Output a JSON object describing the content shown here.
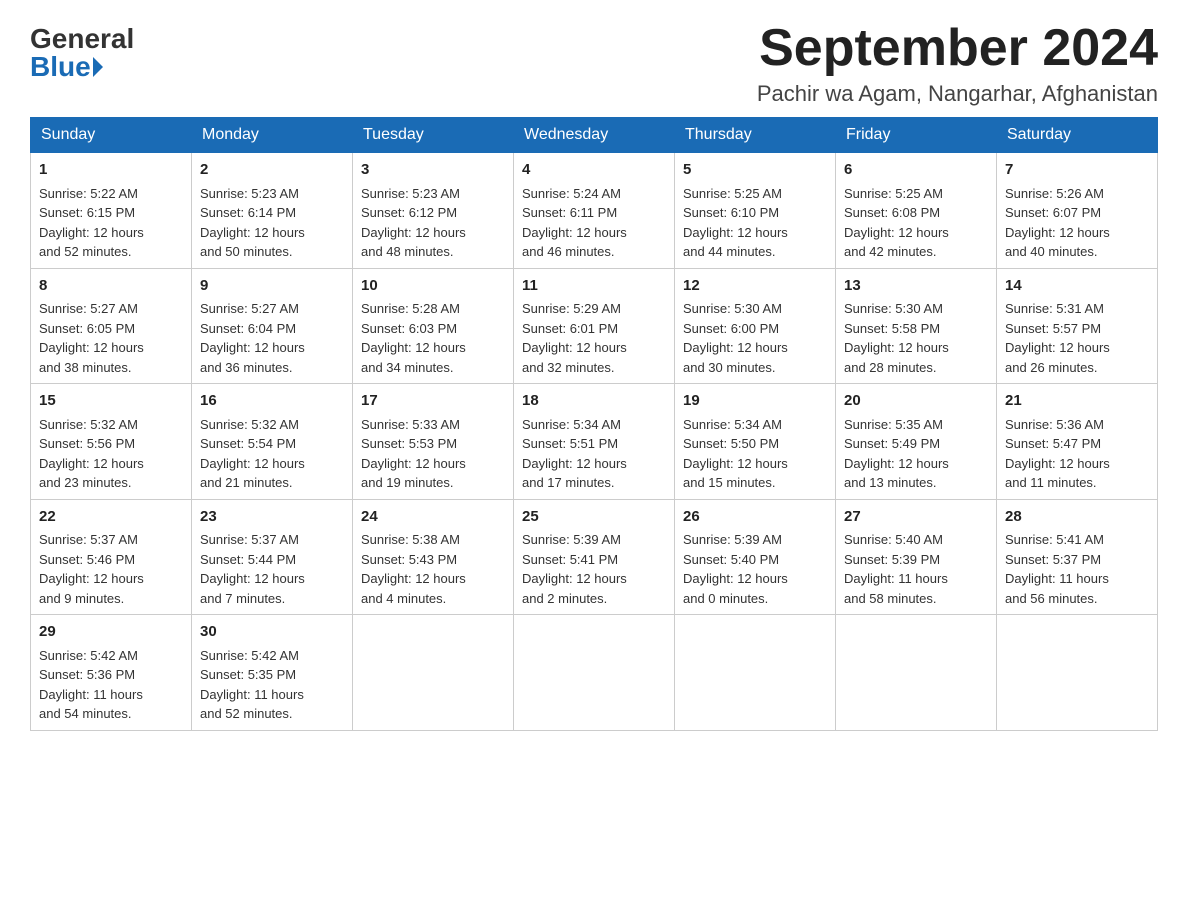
{
  "header": {
    "title": "September 2024",
    "subtitle": "Pachir wa Agam, Nangarhar, Afghanistan",
    "logo_general": "General",
    "logo_blue": "Blue"
  },
  "weekdays": [
    "Sunday",
    "Monday",
    "Tuesday",
    "Wednesday",
    "Thursday",
    "Friday",
    "Saturday"
  ],
  "weeks": [
    [
      {
        "day": "1",
        "sunrise": "5:22 AM",
        "sunset": "6:15 PM",
        "daylight": "12 hours and 52 minutes."
      },
      {
        "day": "2",
        "sunrise": "5:23 AM",
        "sunset": "6:14 PM",
        "daylight": "12 hours and 50 minutes."
      },
      {
        "day": "3",
        "sunrise": "5:23 AM",
        "sunset": "6:12 PM",
        "daylight": "12 hours and 48 minutes."
      },
      {
        "day": "4",
        "sunrise": "5:24 AM",
        "sunset": "6:11 PM",
        "daylight": "12 hours and 46 minutes."
      },
      {
        "day": "5",
        "sunrise": "5:25 AM",
        "sunset": "6:10 PM",
        "daylight": "12 hours and 44 minutes."
      },
      {
        "day": "6",
        "sunrise": "5:25 AM",
        "sunset": "6:08 PM",
        "daylight": "12 hours and 42 minutes."
      },
      {
        "day": "7",
        "sunrise": "5:26 AM",
        "sunset": "6:07 PM",
        "daylight": "12 hours and 40 minutes."
      }
    ],
    [
      {
        "day": "8",
        "sunrise": "5:27 AM",
        "sunset": "6:05 PM",
        "daylight": "12 hours and 38 minutes."
      },
      {
        "day": "9",
        "sunrise": "5:27 AM",
        "sunset": "6:04 PM",
        "daylight": "12 hours and 36 minutes."
      },
      {
        "day": "10",
        "sunrise": "5:28 AM",
        "sunset": "6:03 PM",
        "daylight": "12 hours and 34 minutes."
      },
      {
        "day": "11",
        "sunrise": "5:29 AM",
        "sunset": "6:01 PM",
        "daylight": "12 hours and 32 minutes."
      },
      {
        "day": "12",
        "sunrise": "5:30 AM",
        "sunset": "6:00 PM",
        "daylight": "12 hours and 30 minutes."
      },
      {
        "day": "13",
        "sunrise": "5:30 AM",
        "sunset": "5:58 PM",
        "daylight": "12 hours and 28 minutes."
      },
      {
        "day": "14",
        "sunrise": "5:31 AM",
        "sunset": "5:57 PM",
        "daylight": "12 hours and 26 minutes."
      }
    ],
    [
      {
        "day": "15",
        "sunrise": "5:32 AM",
        "sunset": "5:56 PM",
        "daylight": "12 hours and 23 minutes."
      },
      {
        "day": "16",
        "sunrise": "5:32 AM",
        "sunset": "5:54 PM",
        "daylight": "12 hours and 21 minutes."
      },
      {
        "day": "17",
        "sunrise": "5:33 AM",
        "sunset": "5:53 PM",
        "daylight": "12 hours and 19 minutes."
      },
      {
        "day": "18",
        "sunrise": "5:34 AM",
        "sunset": "5:51 PM",
        "daylight": "12 hours and 17 minutes."
      },
      {
        "day": "19",
        "sunrise": "5:34 AM",
        "sunset": "5:50 PM",
        "daylight": "12 hours and 15 minutes."
      },
      {
        "day": "20",
        "sunrise": "5:35 AM",
        "sunset": "5:49 PM",
        "daylight": "12 hours and 13 minutes."
      },
      {
        "day": "21",
        "sunrise": "5:36 AM",
        "sunset": "5:47 PM",
        "daylight": "12 hours and 11 minutes."
      }
    ],
    [
      {
        "day": "22",
        "sunrise": "5:37 AM",
        "sunset": "5:46 PM",
        "daylight": "12 hours and 9 minutes."
      },
      {
        "day": "23",
        "sunrise": "5:37 AM",
        "sunset": "5:44 PM",
        "daylight": "12 hours and 7 minutes."
      },
      {
        "day": "24",
        "sunrise": "5:38 AM",
        "sunset": "5:43 PM",
        "daylight": "12 hours and 4 minutes."
      },
      {
        "day": "25",
        "sunrise": "5:39 AM",
        "sunset": "5:41 PM",
        "daylight": "12 hours and 2 minutes."
      },
      {
        "day": "26",
        "sunrise": "5:39 AM",
        "sunset": "5:40 PM",
        "daylight": "12 hours and 0 minutes."
      },
      {
        "day": "27",
        "sunrise": "5:40 AM",
        "sunset": "5:39 PM",
        "daylight": "11 hours and 58 minutes."
      },
      {
        "day": "28",
        "sunrise": "5:41 AM",
        "sunset": "5:37 PM",
        "daylight": "11 hours and 56 minutes."
      }
    ],
    [
      {
        "day": "29",
        "sunrise": "5:42 AM",
        "sunset": "5:36 PM",
        "daylight": "11 hours and 54 minutes."
      },
      {
        "day": "30",
        "sunrise": "5:42 AM",
        "sunset": "5:35 PM",
        "daylight": "11 hours and 52 minutes."
      },
      null,
      null,
      null,
      null,
      null
    ]
  ],
  "labels": {
    "sunrise": "Sunrise:",
    "sunset": "Sunset:",
    "daylight": "Daylight:"
  }
}
